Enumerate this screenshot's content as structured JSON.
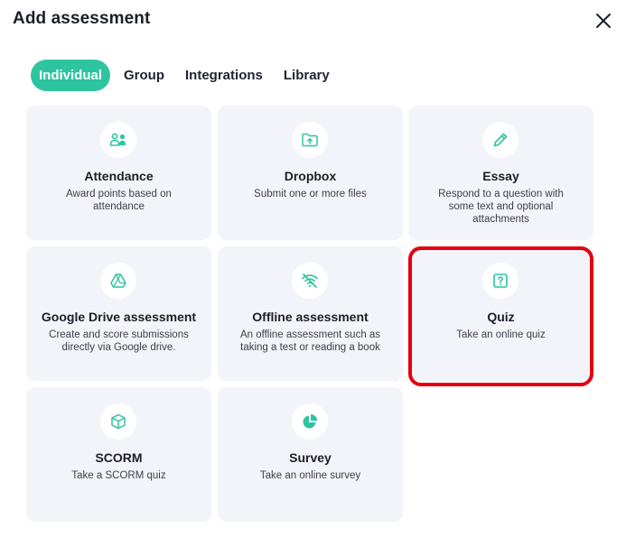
{
  "modal": {
    "title": "Add assessment",
    "close_icon": "close-icon"
  },
  "tabs": [
    {
      "label": "Individual",
      "active": true
    },
    {
      "label": "Group",
      "active": false
    },
    {
      "label": "Integrations",
      "active": false
    },
    {
      "label": "Library",
      "active": false
    }
  ],
  "cards": [
    {
      "name": "Attendance",
      "description": "Award points based on attendance",
      "icon": "users-icon"
    },
    {
      "name": "Dropbox",
      "description": "Submit one or more files",
      "icon": "folder-upload-icon"
    },
    {
      "name": "Essay",
      "description": "Respond to a question with some text and optional attachments",
      "icon": "pencil-icon"
    },
    {
      "name": "Google Drive assessment",
      "description": "Create and score submissions directly via Google drive.",
      "icon": "google-drive-icon"
    },
    {
      "name": "Offline assessment",
      "description": "An offline assessment such as taking a test or reading a book",
      "icon": "wifi-off-icon"
    },
    {
      "name": "Quiz",
      "description": "Take an online quiz",
      "icon": "question-square-icon",
      "highlighted": true
    },
    {
      "name": "SCORM",
      "description": "Take a SCORM quiz",
      "icon": "cube-icon"
    },
    {
      "name": "Survey",
      "description": "Take an online survey",
      "icon": "pie-chart-icon"
    }
  ],
  "colors": {
    "accent": "#2ec4a0",
    "card_bg": "#f2f4f9",
    "highlight": "#e3000f"
  }
}
